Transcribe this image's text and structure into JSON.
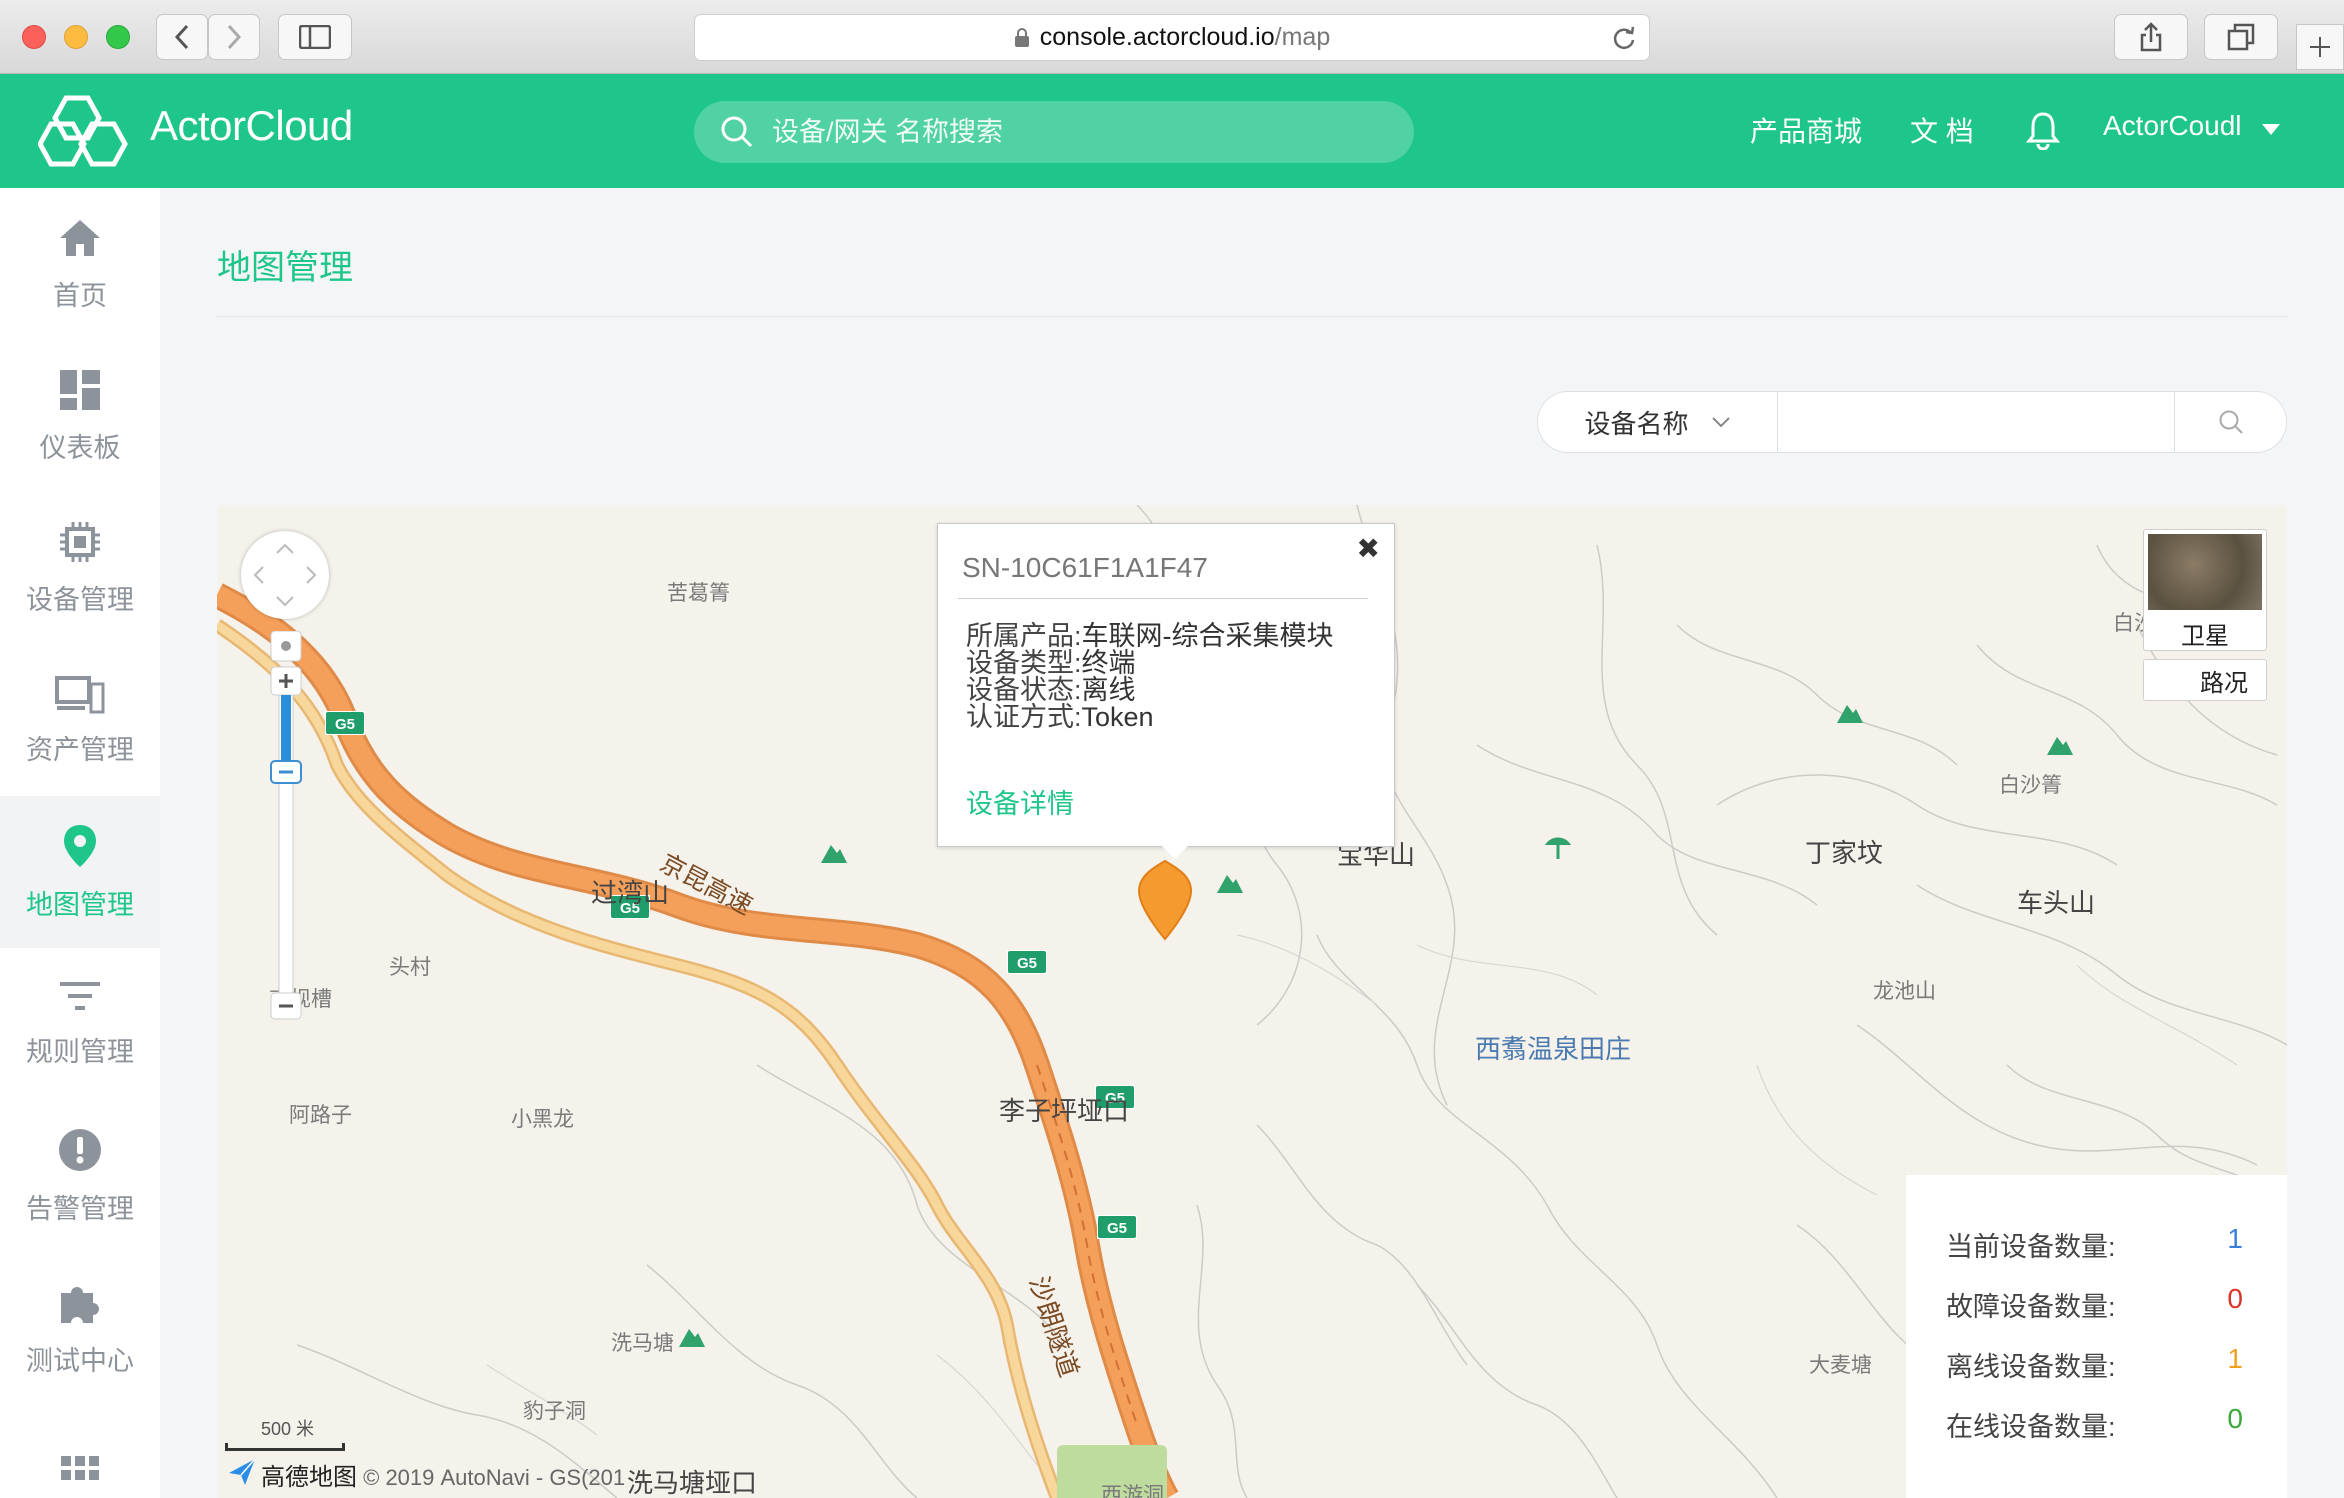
{
  "browser": {
    "url_host": "console.actorcloud.io",
    "url_path": "/map"
  },
  "header": {
    "logo_text": "ActorCloud",
    "search_placeholder": "设备/网关 名称搜索",
    "links": [
      "产品商城",
      "文 档"
    ],
    "user_name": "ActorCoudl"
  },
  "sidebar": {
    "items": [
      {
        "label": "首页",
        "icon": "home-icon"
      },
      {
        "label": "仪表板",
        "icon": "dashboard-icon"
      },
      {
        "label": "设备管理",
        "icon": "chip-icon"
      },
      {
        "label": "资产管理",
        "icon": "devices-icon"
      },
      {
        "label": "地图管理",
        "icon": "map-pin-icon",
        "active": true
      },
      {
        "label": "规则管理",
        "icon": "filter-icon"
      },
      {
        "label": "告警管理",
        "icon": "alert-icon"
      },
      {
        "label": "测试中心",
        "icon": "puzzle-icon"
      }
    ]
  },
  "page": {
    "title": "地图管理"
  },
  "filter": {
    "select_value": "设备名称",
    "input_value": ""
  },
  "map": {
    "popup": {
      "serial": "SN-10C61F1A1F47",
      "rows": [
        {
          "key": "所属产品:",
          "value": "车联网-综合采集模块"
        },
        {
          "key": "设备类型:",
          "value": "终端"
        },
        {
          "key": "设备状态:",
          "value": "离线"
        },
        {
          "key": "认证方式:",
          "value": "Token"
        }
      ],
      "detail_link": "设备详情",
      "close": "✖"
    },
    "layer_buttons": {
      "satellite": "卫星",
      "traffic": "路况"
    },
    "places": [
      {
        "name": "苦葛箐"
      },
      {
        "name": "过湾山"
      },
      {
        "name": "头村"
      },
      {
        "name": "高枧槽"
      },
      {
        "name": "阿路子"
      },
      {
        "name": "小黑龙"
      },
      {
        "name": "李子坪垭口"
      },
      {
        "name": "洗马塘"
      },
      {
        "name": "豹子洞"
      },
      {
        "name": "洗马塘垭口"
      },
      {
        "name": "宝华山"
      },
      {
        "name": "丁家坟"
      },
      {
        "name": "车头山"
      },
      {
        "name": "白沙箐"
      },
      {
        "name": "龙池山"
      },
      {
        "name": "西翥温泉田庄"
      },
      {
        "name": "大麦塘"
      },
      {
        "name": "白沙"
      },
      {
        "name": "京昆高速"
      },
      {
        "name": "沙朗隧道"
      },
      {
        "name": "西游洞"
      }
    ],
    "highway_shield": "G5",
    "scale_label": "500 米",
    "copyright_brand": "高德地图",
    "copyright_text": "© 2019 AutoNavi - GS(201"
  },
  "stats": [
    {
      "label": "当前设备数量:",
      "value": "1",
      "color": "#3b7ddd"
    },
    {
      "label": "故障设备数量:",
      "value": "0",
      "color": "#d9342b"
    },
    {
      "label": "离线设备数量:",
      "value": "1",
      "color": "#f0a020"
    },
    {
      "label": "在线设备数量:",
      "value": "0",
      "color": "#3aa83a"
    }
  ],
  "colors": {
    "brand": "#1fc68a",
    "highway": "#f5a05a",
    "road": "#f7cf8a",
    "marker": "#f59a2e"
  }
}
